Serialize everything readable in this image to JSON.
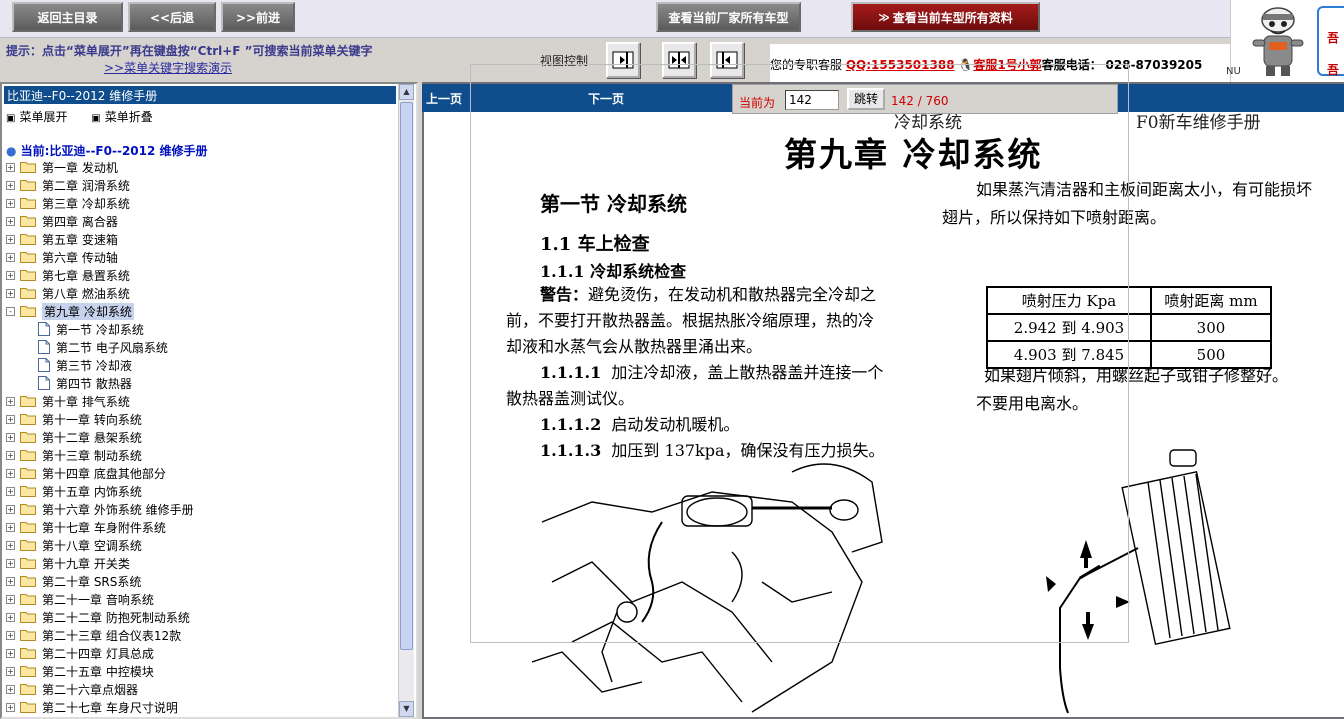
{
  "toolbar": {
    "back_main": "返回主目录",
    "back": "<<后退",
    "forward": ">>前进",
    "view_all_makers": "查看当前厂家所有车型",
    "view_all_models": "查看当前车型所有资料",
    "view_all_models_arrow": "≫"
  },
  "hint": {
    "text": "提示：点击“菜单展开”再在键盘按“Ctrl+F ”可搜索当前菜单关键字",
    "link": ">>菜单关键字搜索演示"
  },
  "view_control": {
    "label": "视图控制",
    "buttons": [
      "right-panel-icon",
      "split-panel-icon",
      "left-panel-icon"
    ]
  },
  "contact": {
    "prefix": "您的专职客服",
    "qq": "QQ:1553501388",
    "service": "客服1号小郭",
    "phone_label": "客服电话：",
    "phone": "028-87039205",
    "nu": "NU"
  },
  "brand": {
    "bubble_line1": "吾",
    "bubble_line2": "吾"
  },
  "tree": {
    "title": "比亚迪--F0--2012 维修手册",
    "expand": "菜单展开",
    "collapse": "菜单折叠",
    "root": "当前:比亚迪--F0--2012 维修手册",
    "items": [
      {
        "label": "第一章  发动机",
        "type": "folder",
        "pm": "+",
        "level": 0
      },
      {
        "label": "第二章  润滑系统",
        "type": "folder",
        "pm": "+",
        "level": 0
      },
      {
        "label": "第三章  冷却系统",
        "type": "folder",
        "pm": "+",
        "level": 0
      },
      {
        "label": "第四章  离合器",
        "type": "folder",
        "pm": "+",
        "level": 0
      },
      {
        "label": "第五章  变速箱",
        "type": "folder",
        "pm": "+",
        "level": 0
      },
      {
        "label": "第六章  传动轴",
        "type": "folder",
        "pm": "+",
        "level": 0
      },
      {
        "label": "第七章  悬置系统",
        "type": "folder",
        "pm": "+",
        "level": 0
      },
      {
        "label": "第八章  燃油系统",
        "type": "folder",
        "pm": "+",
        "level": 0
      },
      {
        "label": "第九章  冷却系统",
        "type": "folder",
        "pm": "-",
        "level": 0,
        "selected": true
      },
      {
        "label": "第一节  冷却系统",
        "type": "doc",
        "level": 1
      },
      {
        "label": "第二节  电子风扇系统",
        "type": "doc",
        "level": 1
      },
      {
        "label": "第三节  冷却液",
        "type": "doc",
        "level": 1
      },
      {
        "label": "第四节  散热器",
        "type": "doc",
        "level": 1
      },
      {
        "label": "第十章  排气系统",
        "type": "folder",
        "pm": "+",
        "level": 0
      },
      {
        "label": "第十一章  转向系统",
        "type": "folder",
        "pm": "+",
        "level": 0
      },
      {
        "label": "第十二章  悬架系统",
        "type": "folder",
        "pm": "+",
        "level": 0
      },
      {
        "label": "第十三章  制动系统",
        "type": "folder",
        "pm": "+",
        "level": 0
      },
      {
        "label": "第十四章  底盘其他部分",
        "type": "folder",
        "pm": "+",
        "level": 0
      },
      {
        "label": "第十五章  内饰系统",
        "type": "folder",
        "pm": "+",
        "level": 0
      },
      {
        "label": "第十六章  外饰系统 维修手册",
        "type": "folder",
        "pm": "+",
        "level": 0
      },
      {
        "label": "第十七章  车身附件系统",
        "type": "folder",
        "pm": "+",
        "level": 0
      },
      {
        "label": "第十八章  空调系统",
        "type": "folder",
        "pm": "+",
        "level": 0
      },
      {
        "label": "第十九章  开关类",
        "type": "folder",
        "pm": "+",
        "level": 0
      },
      {
        "label": "第二十章  SRS系统",
        "type": "folder",
        "pm": "+",
        "level": 0
      },
      {
        "label": "第二十一章  音响系统",
        "type": "folder",
        "pm": "+",
        "level": 0
      },
      {
        "label": "第二十二章  防抱死制动系统",
        "type": "folder",
        "pm": "+",
        "level": 0
      },
      {
        "label": "第二十三章  组合仪表12款",
        "type": "folder",
        "pm": "+",
        "level": 0
      },
      {
        "label": "第二十四章  灯具总成",
        "type": "folder",
        "pm": "+",
        "level": 0
      },
      {
        "label": "第二十五章  中控模块",
        "type": "folder",
        "pm": "+",
        "level": 0
      },
      {
        "label": "第二十六章点烟器",
        "type": "folder",
        "pm": "+",
        "level": 0
      },
      {
        "label": "第二十七章  车身尺寸说明",
        "type": "folder",
        "pm": "+",
        "level": 0
      }
    ]
  },
  "viewer": {
    "prev": "上一页",
    "next": "下一页",
    "current_label": "当前为",
    "current_page": "142",
    "go": "跳转",
    "count": "142 / 760"
  },
  "doc": {
    "header_left": "冷却系统",
    "header_right": "F0新车维修手册",
    "chapter": "第九章  冷却系统",
    "section": "第一节  冷却系统",
    "h11": "1.1   车上检查",
    "h111": "1.1.1   冷却系统检查",
    "warn_label": "警告：",
    "warn_line1": "避免烫伤，在发动机和散热器完全冷却之",
    "warn_line2": "前，不要打开散热器盖。根据热胀冷缩原理，热的冷",
    "warn_line3": "却液和水蒸气会从散热器里涌出来。",
    "step1_num": "1.1.1.1",
    "step1_a": "加注冷却液，盖上散热器盖并连接一个",
    "step1_b": "散热器盖测试仪。",
    "step2_num": "1.1.1.2",
    "step2": "启动发动机暖机。",
    "step3_num": "1.1.1.3",
    "step3": "加压到 137kpa，确保没有压力损失。",
    "right_p1_a": "如果蒸汽清洁器和主板间距离太小，有可能损坏",
    "right_p1_b": "翅片，所以保持如下喷射距离。",
    "table": {
      "headers": [
        "喷射压力 Kpa",
        "喷射距离 mm"
      ],
      "rows": [
        [
          "2.942 到 4.903",
          "300"
        ],
        [
          "4.903 到 7.845",
          "500"
        ]
      ]
    },
    "right_p2_a": "如果翅片倾斜，用螺丝起子或钳子修整好。",
    "right_p2_b": "不要用电离水。"
  }
}
